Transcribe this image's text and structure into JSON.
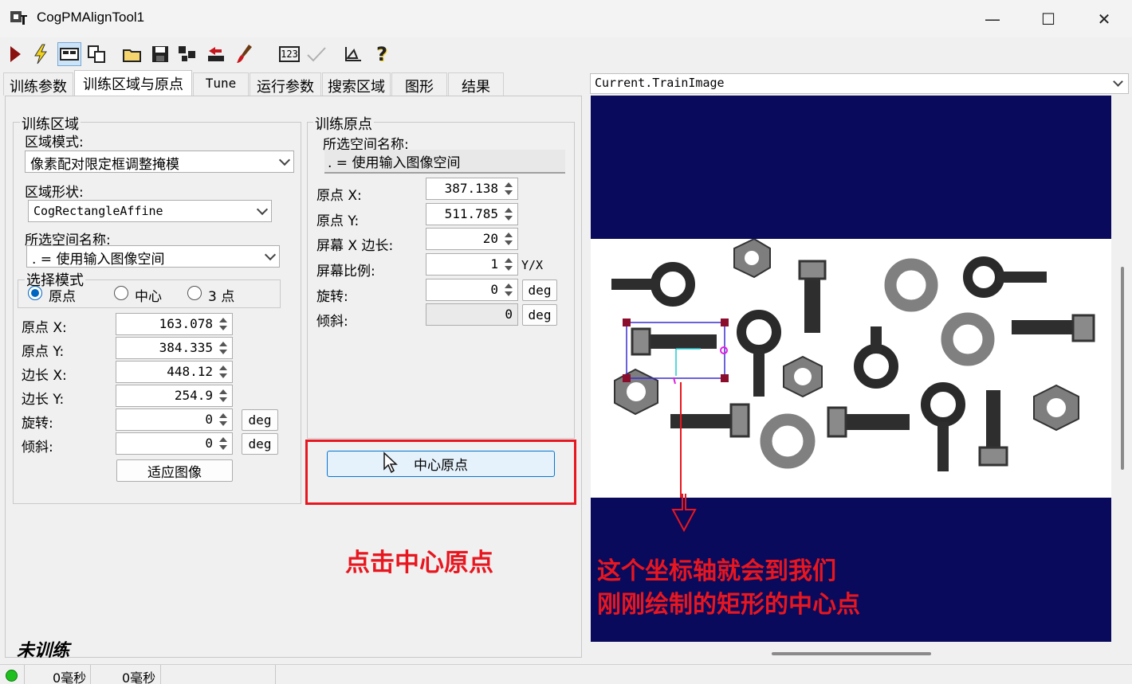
{
  "window": {
    "title": "CogPMAlignTool1",
    "minimize_glyph": "—",
    "maximize_glyph": "☐",
    "close_glyph": "✕"
  },
  "toolbar": {
    "icons": [
      "run-icon",
      "electric-icon",
      "show-icon",
      "copy-icon",
      "open-folder-icon",
      "save-icon",
      "network-icon",
      "import-icon",
      "brush-icon",
      "numbers-icon",
      "checkmark-icon",
      "ruler-icon",
      "help-icon"
    ],
    "numbers_label": "123",
    "help_glyph": "?"
  },
  "tabs": [
    {
      "label": "训练参数"
    },
    {
      "label": "训练区域与原点"
    },
    {
      "label": "Tune"
    },
    {
      "label": "运行参数"
    },
    {
      "label": "搜索区域"
    },
    {
      "label": "图形"
    },
    {
      "label": "结果"
    }
  ],
  "train_region": {
    "group_label": "训练区域",
    "mode_label": "区域模式:",
    "mode_value": "像素配对限定框调整掩模",
    "shape_label": "区域形状:",
    "shape_value": "CogRectangleAffine",
    "space_label": "所选空间名称:",
    "space_value": ". = 使用输入图像空间",
    "select_mode_label": "选择模式",
    "radio_origin": "原点",
    "radio_center": "中心",
    "radio_3pt": "3 点",
    "fields": [
      {
        "label": "原点 X:",
        "value": "163.078"
      },
      {
        "label": "原点 Y:",
        "value": "384.335"
      },
      {
        "label": "边长 X:",
        "value": "448.12"
      },
      {
        "label": "边长 Y:",
        "value": "254.9"
      },
      {
        "label": "旋转:",
        "value": "0"
      },
      {
        "label": "倾斜:",
        "value": "0"
      }
    ],
    "deg_label": "deg",
    "fit_button": "适应图像"
  },
  "train_origin": {
    "group_label": "训练原点",
    "space_label": "所选空间名称:",
    "space_value": ". = 使用输入图像空间",
    "fields": [
      {
        "label": "原点 X:",
        "value": "387.138"
      },
      {
        "label": "原点 Y:",
        "value": "511.785"
      },
      {
        "label": "屏幕 X 边长:",
        "value": "20"
      },
      {
        "label": "屏幕比例:",
        "value": "1"
      },
      {
        "label": "旋转:",
        "value": "0"
      },
      {
        "label": "倾斜:",
        "value": "0"
      }
    ],
    "yx_label": "Y/X",
    "deg_label": "deg",
    "center_button": "中心原点"
  },
  "image_view": {
    "selector": "Current.TrainImage"
  },
  "annotations": {
    "click_hint": "点击中心原点",
    "note_line1": "这个坐标轴就会到我们",
    "note_line2": "刚刚绘制的矩形的中心点"
  },
  "status": {
    "trained_state": "未训练",
    "time1": "0毫秒",
    "time2": "0毫秒"
  },
  "colors": {
    "annotation": "#e8161f",
    "image_bg": "#0a0a5c",
    "region_box": "#3a2fd0",
    "handle": "#8b0d2c",
    "status_ok": "#1fbf1f"
  }
}
